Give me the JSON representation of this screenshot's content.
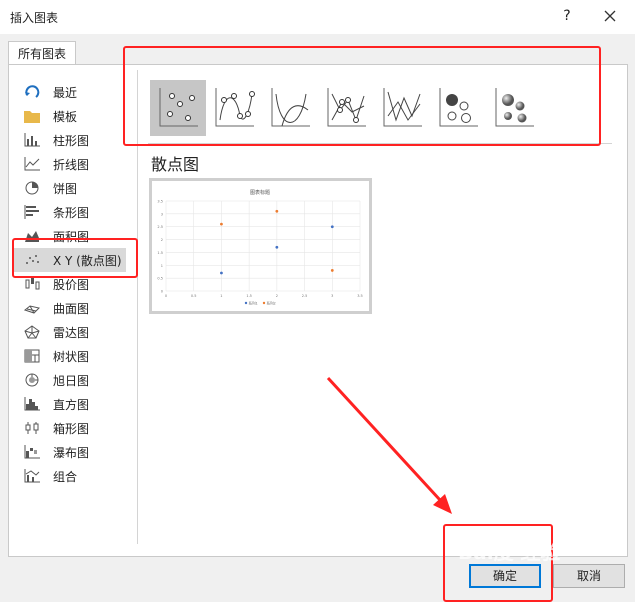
{
  "window": {
    "title": "插入图表",
    "help": "?"
  },
  "tab": {
    "label": "所有图表"
  },
  "sidebar": {
    "items": [
      {
        "label": "最近"
      },
      {
        "label": "模板"
      },
      {
        "label": "柱形图"
      },
      {
        "label": "折线图"
      },
      {
        "label": "饼图"
      },
      {
        "label": "条形图"
      },
      {
        "label": "面积图"
      },
      {
        "label": "X Y (散点图)"
      },
      {
        "label": "股价图"
      },
      {
        "label": "曲面图"
      },
      {
        "label": "雷达图"
      },
      {
        "label": "树状图"
      },
      {
        "label": "旭日图"
      },
      {
        "label": "直方图"
      },
      {
        "label": "箱形图"
      },
      {
        "label": "瀑布图"
      },
      {
        "label": "组合"
      }
    ],
    "selected": "X Y (散点图)"
  },
  "main": {
    "type_title": "散点图",
    "subtype_icons": [
      "scatter-icon",
      "scatter-smooth-markers-icon",
      "scatter-smooth-icon",
      "scatter-straight-markers-icon",
      "scatter-straight-icon",
      "bubble-icon",
      "bubble-3d-icon"
    ]
  },
  "chart_data": {
    "type": "scatter",
    "title": "图表标题",
    "xlim": [
      0,
      3.5
    ],
    "ylim": [
      0,
      3.5
    ],
    "x_ticks": [
      "0",
      "0.5",
      "1",
      "1.5",
      "2",
      "2.5",
      "3",
      "3.5"
    ],
    "y_ticks": [
      "0",
      "0.5",
      "1",
      "1.5",
      "2",
      "2.5",
      "3",
      "3.5"
    ],
    "series": [
      {
        "name": "系列1",
        "color": "#4472c4",
        "x": [
          1,
          2,
          3
        ],
        "y": [
          0.7,
          1.7,
          2.5
        ]
      },
      {
        "name": "系列2",
        "color": "#ed7d31",
        "x": [
          1,
          2,
          3
        ],
        "y": [
          2.6,
          3.1,
          0.8
        ]
      }
    ]
  },
  "buttons": {
    "ok": "确定",
    "cancel": "取消"
  },
  "watermark": "Bai度 经验",
  "colors": {
    "annotation": "#ff2222",
    "selected": "#c6c6c6"
  }
}
